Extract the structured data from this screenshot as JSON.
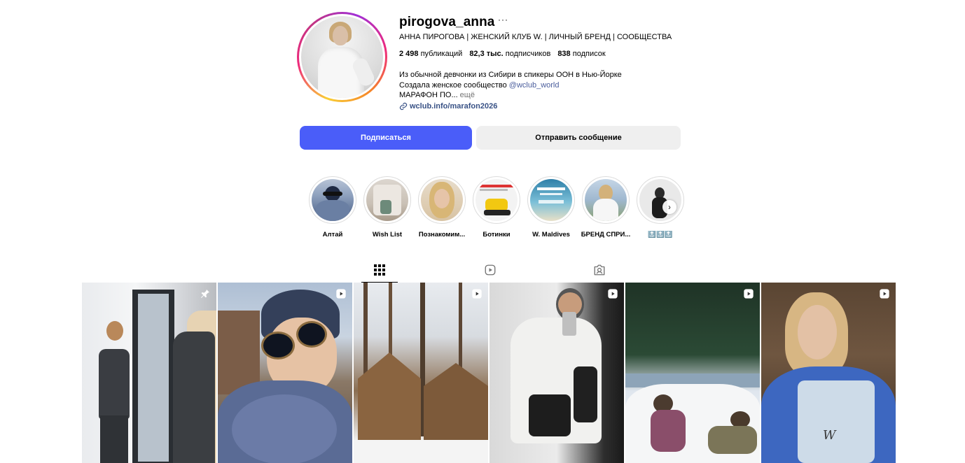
{
  "profile": {
    "username": "pirogova_anna",
    "more_label": "···",
    "full_name": "АННА ПИРОГОВА | ЖЕНСКИЙ КЛУБ W. | ЛИЧНЫЙ БРЕНД | СООБЩЕСТВА",
    "stats": {
      "posts_value": "2 498",
      "posts_label": "публикаций",
      "followers_value": "82,3 тыс.",
      "followers_label": "подписчиков",
      "following_value": "838",
      "following_label": "подписок"
    },
    "bio": {
      "line1": "Из обычной девчонки из Сибири в спикеры ООН в Нью-Йорке",
      "line2_prefix": "Создала женское сообщество ",
      "line2_mention": "@wclub_world",
      "line3": "МАРАФОН ПО...",
      "more": " ещё"
    },
    "link": "wclub.info/marafon2026"
  },
  "actions": {
    "follow": "Подписаться",
    "message": "Отправить сообщение"
  },
  "highlights": [
    {
      "label": "Алтай",
      "icon": "highlight-altai"
    },
    {
      "label": "Wish List",
      "icon": "highlight-wishlist"
    },
    {
      "label": "Познакомим...",
      "icon": "highlight-meet"
    },
    {
      "label": "Ботинки",
      "icon": "highlight-boots"
    },
    {
      "label": "W. Maldives",
      "icon": "highlight-maldives"
    },
    {
      "label": "БРЕНД СПРИ...",
      "icon": "highlight-brand"
    },
    {
      "label": "🔝🔝🔝",
      "icon": "highlight-top"
    }
  ],
  "tabs": [
    {
      "name": "posts",
      "icon": "grid-icon",
      "active": true
    },
    {
      "name": "reels",
      "icon": "reels-icon",
      "active": false
    },
    {
      "name": "tagged",
      "icon": "tagged-icon",
      "active": false
    }
  ],
  "posts": [
    {
      "type": "pinned",
      "icon": "pin-icon"
    },
    {
      "type": "reel",
      "icon": "reel-icon"
    },
    {
      "type": "reel",
      "icon": "reel-icon"
    },
    {
      "type": "reel",
      "icon": "reel-icon"
    },
    {
      "type": "reel",
      "icon": "reel-icon"
    },
    {
      "type": "reel",
      "icon": "reel-icon"
    }
  ],
  "colors": {
    "follow_button": "#4a5df9",
    "link": "#385185",
    "mention": "#4a5d9c"
  }
}
